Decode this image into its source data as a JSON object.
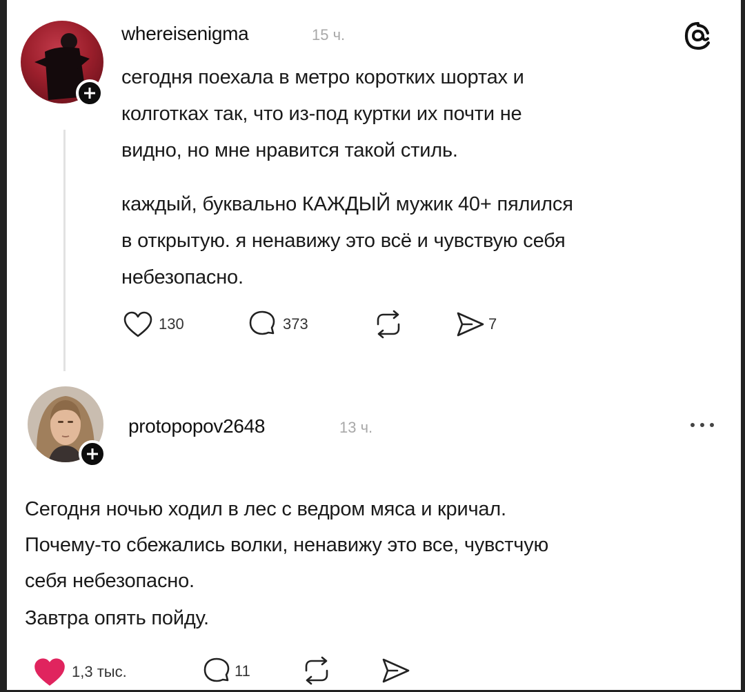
{
  "post1": {
    "username": "whereisenigma",
    "time": "15 ч.",
    "paragraph1": [
      "сегодня поехала в метро коротких шортах и",
      "колготках так, что из-под куртки их почти не",
      "видно, но мне нравится такой стиль."
    ],
    "paragraph2": [
      "каждый, буквально КАЖДЫЙ мужик 40+ пялился",
      "в открытую. я ненавижу это всё и чувствую себя",
      "небезопасно."
    ],
    "likes": "130",
    "replies": "373",
    "shares": "7",
    "icons": [
      "heart-icon",
      "comment-icon",
      "repost-icon",
      "send-icon",
      "threads-logo-icon",
      "plus-icon"
    ]
  },
  "post2": {
    "username": "protopopov2648",
    "time": "13 ч.",
    "lines": [
      "Сегодня ночью ходил в лес с ведром мяса и кричал.",
      "Почему-то сбежались волки, ненавижу это все, чувстчую",
      "себя небезопасно."
    ],
    "line_last": "Завтра опять пойду.",
    "likes": "1,3 тыс.",
    "replies": "11",
    "liked": true,
    "colors": {
      "liked_heart": "#e0245e"
    },
    "icons": [
      "heart-filled-icon",
      "comment-icon",
      "repost-icon",
      "send-icon",
      "more-icon",
      "plus-icon"
    ]
  }
}
